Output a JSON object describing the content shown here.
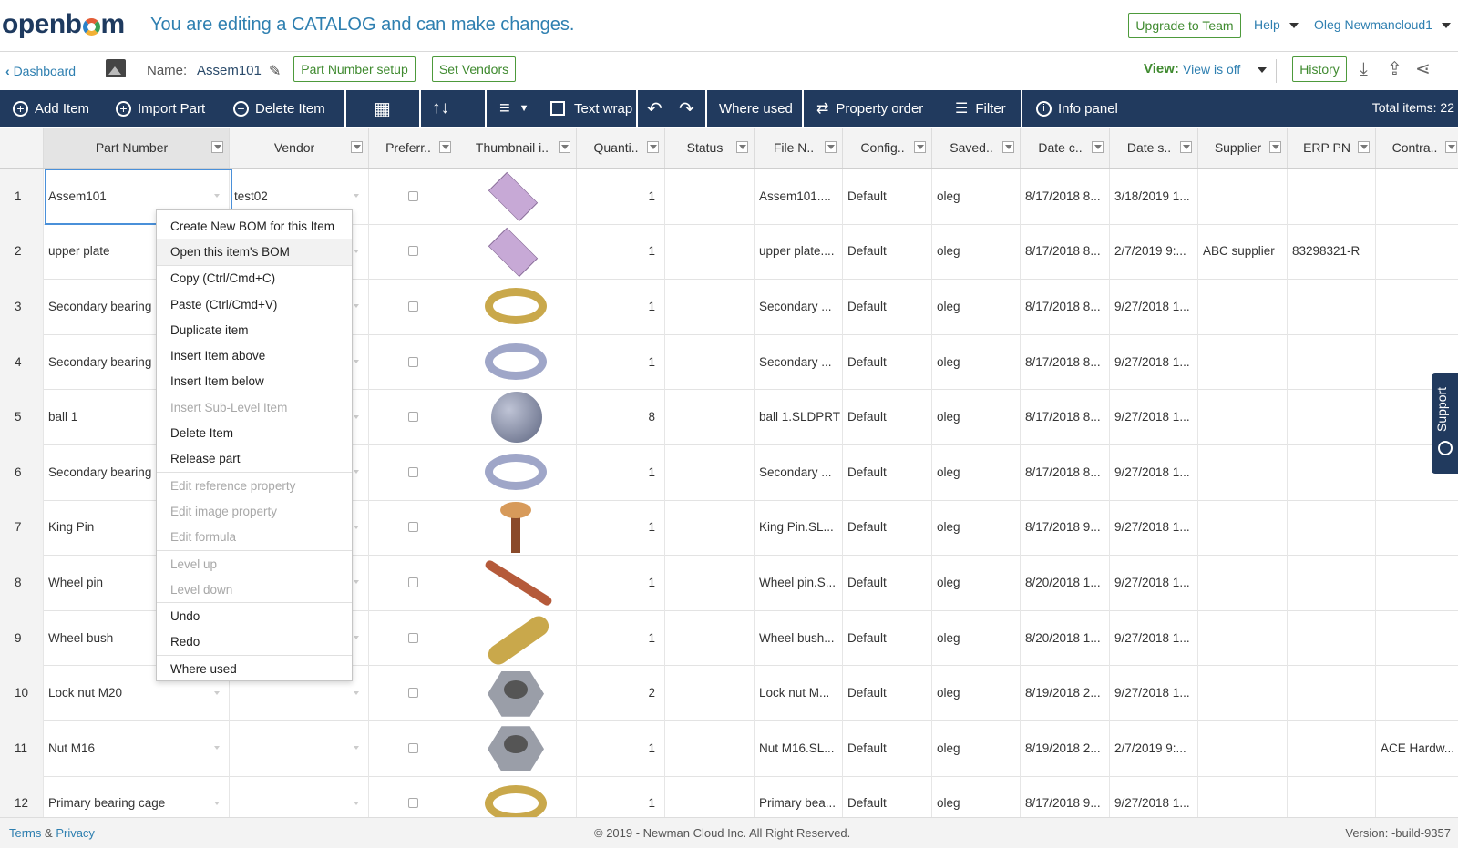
{
  "header": {
    "logo_text_a": "openb",
    "logo_text_b": "m",
    "catalog_message": "You are editing a CATALOG and can make changes.",
    "upgrade_label": "Upgrade to Team",
    "help_label": "Help",
    "user_label": "Oleg Newmancloud1"
  },
  "subheader": {
    "dashboard_label": "Dashboard",
    "name_label": "Name:",
    "name_value": "Assem101",
    "part_number_setup_label": "Part Number setup",
    "set_vendors_label": "Set Vendors",
    "view_label": "View:",
    "view_value": "View is off",
    "history_label": "History"
  },
  "toolbar": {
    "add_item": "Add Item",
    "import_part": "Import Part",
    "delete_item": "Delete Item",
    "text_wrap": "Text wrap",
    "where_used": "Where used",
    "property_order": "Property order",
    "filter": "Filter",
    "info_panel": "Info panel",
    "total_items": "Total items: 22"
  },
  "columns": [
    "Part Number",
    "Vendor",
    "Preferr..",
    "Thumbnail i..",
    "Quanti..",
    "Status",
    "File N..",
    "Config..",
    "Saved..",
    "Date c..",
    "Date s..",
    "Supplier",
    "ERP PN",
    "Contra.."
  ],
  "rows": [
    {
      "n": "1",
      "pn": "Assem101",
      "vendor": "test02",
      "qty": "1",
      "file": "Assem101....",
      "config": "Default",
      "saved": "oleg",
      "datec": "8/17/2018 8...",
      "dates": "3/18/2019 1...",
      "supplier": "",
      "erp": "",
      "contra": "",
      "thumb": "plate"
    },
    {
      "n": "2",
      "pn": "upper plate",
      "vendor": "",
      "qty": "1",
      "file": "upper plate....",
      "config": "Default",
      "saved": "oleg",
      "datec": "8/17/2018 8...",
      "dates": "2/7/2019 9:...",
      "supplier": "ABC supplier",
      "erp": "83298321-R",
      "contra": "",
      "thumb": "plate"
    },
    {
      "n": "3",
      "pn": "Secondary bearing",
      "vendor": "",
      "qty": "1",
      "file": "Secondary ...",
      "config": "Default",
      "saved": "oleg",
      "datec": "8/17/2018 8...",
      "dates": "9/27/2018 1...",
      "supplier": "",
      "erp": "",
      "contra": "",
      "thumb": "ring-gold"
    },
    {
      "n": "4",
      "pn": "Secondary bearing",
      "vendor": "",
      "qty": "1",
      "file": "Secondary ...",
      "config": "Default",
      "saved": "oleg",
      "datec": "8/17/2018 8...",
      "dates": "9/27/2018 1...",
      "supplier": "",
      "erp": "",
      "contra": "",
      "thumb": "ring"
    },
    {
      "n": "5",
      "pn": "ball 1",
      "vendor": "",
      "qty": "8",
      "file": "ball 1.SLDPRT",
      "config": "Default",
      "saved": "oleg",
      "datec": "8/17/2018 8...",
      "dates": "9/27/2018 1...",
      "supplier": "",
      "erp": "",
      "contra": "",
      "thumb": "sphere"
    },
    {
      "n": "6",
      "pn": "Secondary bearing",
      "vendor": "",
      "qty": "1",
      "file": "Secondary ...",
      "config": "Default",
      "saved": "oleg",
      "datec": "8/17/2018 8...",
      "dates": "9/27/2018 1...",
      "supplier": "",
      "erp": "",
      "contra": "",
      "thumb": "ring"
    },
    {
      "n": "7",
      "pn": "King Pin",
      "vendor": "",
      "qty": "1",
      "file": "King Pin.SL...",
      "config": "Default",
      "saved": "oleg",
      "datec": "8/17/2018 9...",
      "dates": "9/27/2018 1...",
      "supplier": "",
      "erp": "",
      "contra": "",
      "thumb": "pin"
    },
    {
      "n": "8",
      "pn": "Wheel pin",
      "vendor": "",
      "qty": "1",
      "file": "Wheel pin.S...",
      "config": "Default",
      "saved": "oleg",
      "datec": "8/20/2018 1...",
      "dates": "9/27/2018 1...",
      "supplier": "",
      "erp": "",
      "contra": "",
      "thumb": "rod"
    },
    {
      "n": "9",
      "pn": "Wheel bush",
      "vendor": "",
      "qty": "1",
      "file": "Wheel bush...",
      "config": "Default",
      "saved": "oleg",
      "datec": "8/20/2018 1...",
      "dates": "9/27/2018 1...",
      "supplier": "",
      "erp": "",
      "contra": "",
      "thumb": "bush"
    },
    {
      "n": "10",
      "pn": "Lock nut M20",
      "vendor": "",
      "qty": "2",
      "file": "Lock nut M...",
      "config": "Default",
      "saved": "oleg",
      "datec": "8/19/2018 2...",
      "dates": "9/27/2018 1...",
      "supplier": "",
      "erp": "",
      "contra": "",
      "thumb": "nut"
    },
    {
      "n": "11",
      "pn": "Nut M16",
      "vendor": "",
      "qty": "1",
      "file": "Nut M16.SL...",
      "config": "Default",
      "saved": "oleg",
      "datec": "8/19/2018 2...",
      "dates": "2/7/2019 9:...",
      "supplier": "",
      "erp": "",
      "contra": "ACE Hardw...",
      "thumb": "nut"
    },
    {
      "n": "12",
      "pn": "Primary bearing cage",
      "vendor": "",
      "qty": "1",
      "file": "Primary bea...",
      "config": "Default",
      "saved": "oleg",
      "datec": "8/17/2018 9...",
      "dates": "9/27/2018 1...",
      "supplier": "",
      "erp": "",
      "contra": "",
      "thumb": "ring-gold"
    }
  ],
  "context_menu": [
    {
      "label": "Create New BOM for this Item",
      "disabled": false
    },
    {
      "label": "Open this item's BOM",
      "disabled": false,
      "hover": true
    },
    {
      "label": "Copy (Ctrl/Cmd+C)",
      "disabled": false,
      "sep": true
    },
    {
      "label": "Paste (Ctrl/Cmd+V)",
      "disabled": false
    },
    {
      "label": "Duplicate item",
      "disabled": false
    },
    {
      "label": "Insert Item above",
      "disabled": false
    },
    {
      "label": "Insert Item below",
      "disabled": false
    },
    {
      "label": "Insert Sub-Level Item",
      "disabled": true
    },
    {
      "label": "Delete Item",
      "disabled": false
    },
    {
      "label": "Release part",
      "disabled": false
    },
    {
      "label": "Edit reference property",
      "disabled": true,
      "sep": true
    },
    {
      "label": "Edit image property",
      "disabled": true
    },
    {
      "label": "Edit formula",
      "disabled": true
    },
    {
      "label": "Level up",
      "disabled": true,
      "sep": true
    },
    {
      "label": "Level down",
      "disabled": true
    },
    {
      "label": "Undo",
      "disabled": false,
      "sep": true
    },
    {
      "label": "Redo",
      "disabled": false
    },
    {
      "label": "Where used",
      "disabled": false,
      "sep": true
    }
  ],
  "support_label": "Support",
  "footer": {
    "terms": "Terms",
    "amp": "&",
    "privacy": "Privacy",
    "copyright": "© 2019 - Newman Cloud Inc. All Right Reserved.",
    "version": "Version: -build-9357"
  },
  "colors": {
    "toolbar_bg": "#213a5e",
    "accent_green": "#3f8a2f",
    "link_blue": "#2e7fb0"
  }
}
